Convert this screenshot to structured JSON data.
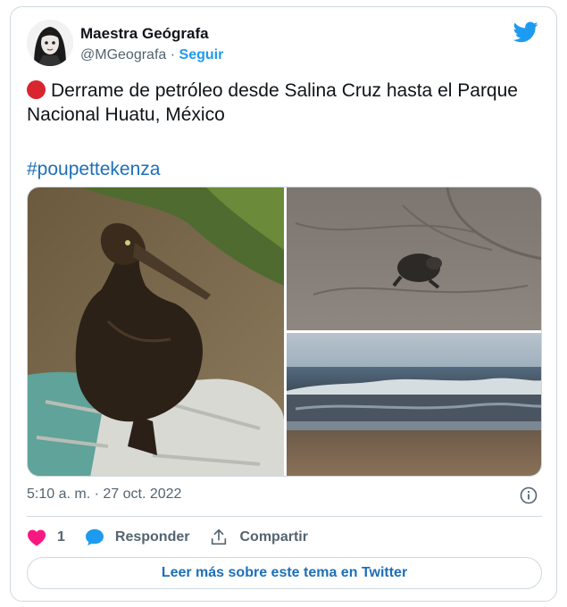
{
  "author": {
    "name": "Maestra Geógrafa",
    "handle": "@MGeografa",
    "separator": "·",
    "follow_label": "Seguir"
  },
  "tweet": {
    "text": "Derrame de petróleo desde Salina Cruz hasta el Parque Nacional Huatu, México",
    "hashtag": "#poupettekenza"
  },
  "media": {
    "images": [
      {
        "description": "oil-covered bird on a towel"
      },
      {
        "description": "oil-covered turtle on the sand"
      },
      {
        "description": "beach with oil-tinted waves"
      }
    ]
  },
  "meta": {
    "timestamp": "5:10 a. m. · 27 oct. 2022"
  },
  "actions": {
    "like_count": "1",
    "reply_label": "Responder",
    "share_label": "Compartir"
  },
  "read_more_label": "Leer más sobre este tema en Twitter",
  "colors": {
    "accent": "#1d9bf0",
    "link": "#1d6fb8",
    "like": "#f91880",
    "muted": "#536471",
    "border": "#cfd9de"
  }
}
